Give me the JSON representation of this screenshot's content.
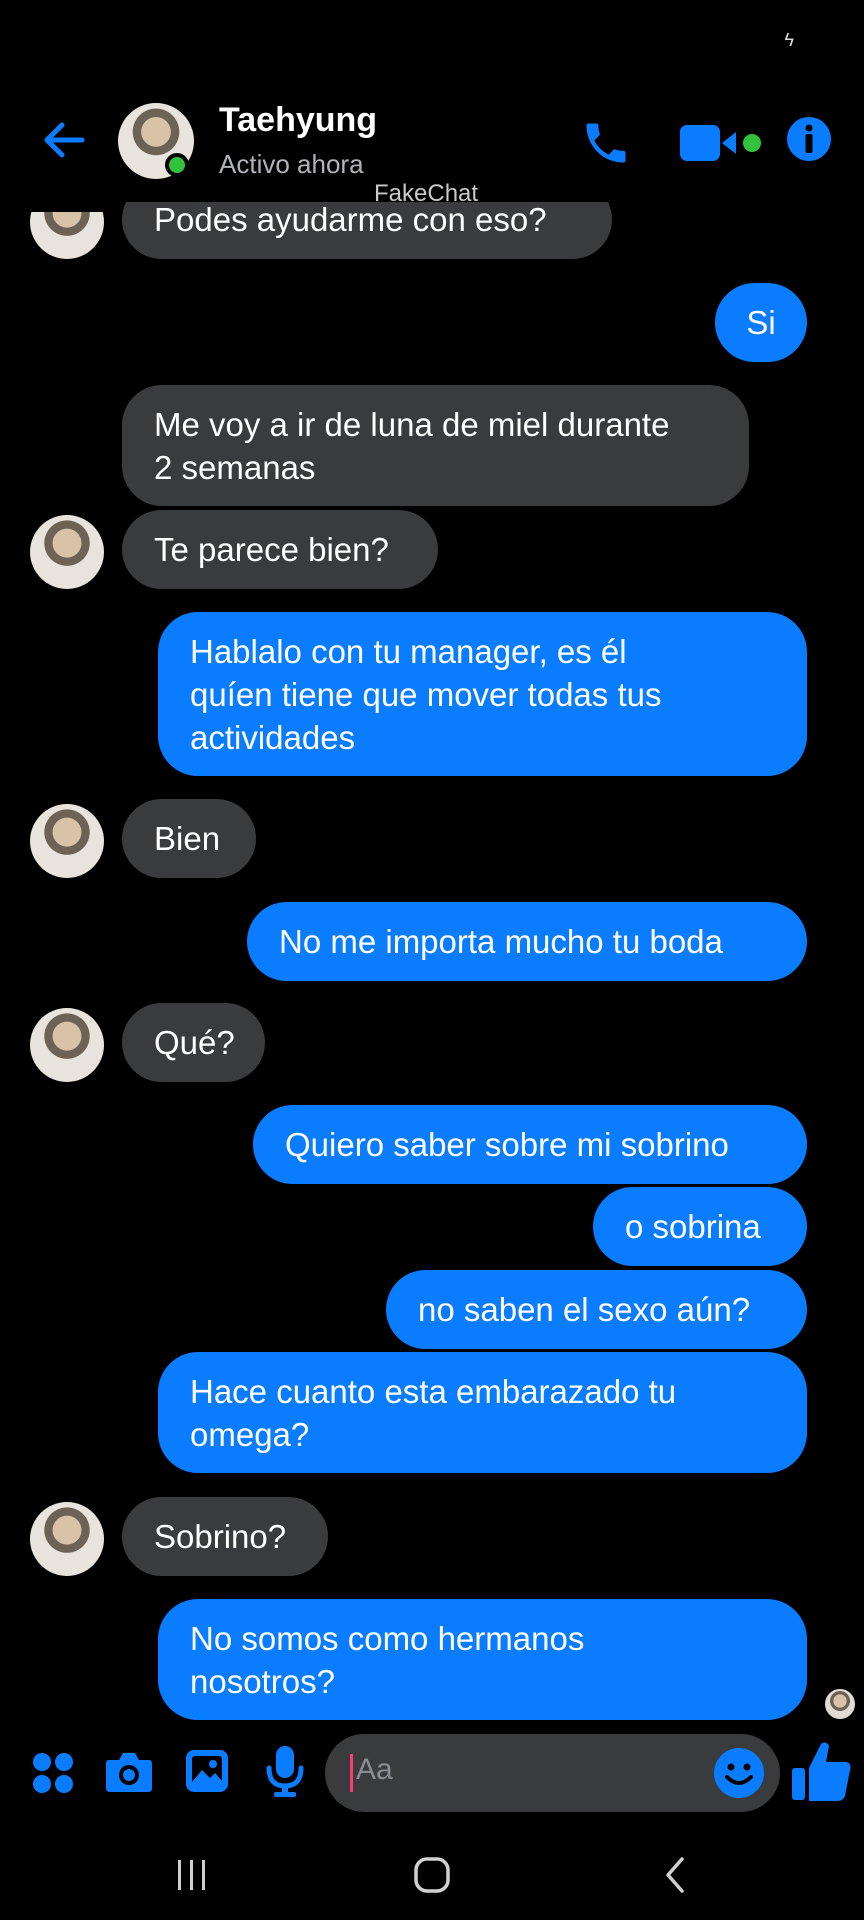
{
  "header": {
    "contact_name": "Taehyung",
    "contact_status": "Activo ahora",
    "watermark": "FakeChat",
    "accent_color": "#0a7cff",
    "online_color": "#31c23c",
    "icons": [
      "back-arrow-icon",
      "phone-icon",
      "video-camera-icon",
      "info-icon"
    ]
  },
  "messages": [
    {
      "side": "in",
      "text": "Podes ayudarme con eso?"
    },
    {
      "side": "out",
      "text": "Si"
    },
    {
      "side": "in",
      "text": "Me voy a ir de luna de miel durante\n2 semanas"
    },
    {
      "side": "in",
      "text": "Te parece bien?"
    },
    {
      "side": "out",
      "text": "Hablalo con tu manager, es él\nquíen tiene que mover todas tus\nactividades"
    },
    {
      "side": "in",
      "text": "Bien"
    },
    {
      "side": "out",
      "text": "No me importa mucho tu boda"
    },
    {
      "side": "in",
      "text": "Qué?"
    },
    {
      "side": "out",
      "text": "Quiero saber sobre mi sobrino"
    },
    {
      "side": "out",
      "text": "o sobrina"
    },
    {
      "side": "out",
      "text": "no saben el sexo aún?"
    },
    {
      "side": "out",
      "text": "Hace cuanto esta embarazado tu\nomega?"
    },
    {
      "side": "in",
      "text": "Sobrino?"
    },
    {
      "side": "out",
      "text": "No somos como hermanos\nnosotros?"
    }
  ],
  "composer": {
    "placeholder": "Aa",
    "icons": [
      "apps-grid-icon",
      "camera-icon",
      "gallery-icon",
      "microphone-icon",
      "emoji-icon",
      "thumbs-up-icon"
    ]
  },
  "navbar": {
    "icons": [
      "recent-apps-icon",
      "home-icon",
      "back-icon"
    ]
  }
}
